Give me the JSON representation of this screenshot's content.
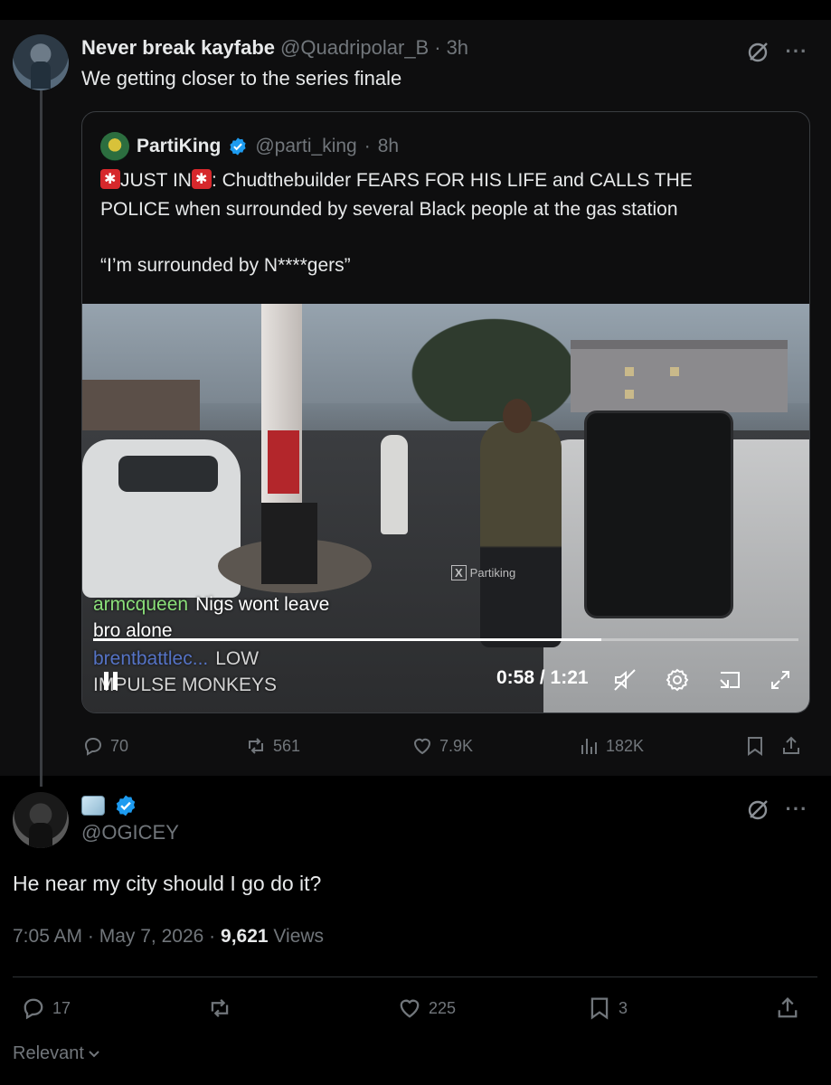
{
  "parent_tweet": {
    "display_name": "Never break kayfabe",
    "handle": "@Quadripolar_B",
    "separator": "·",
    "time": "3h",
    "text": "We getting closer to the series finale"
  },
  "quoted_tweet": {
    "display_name": "PartiKing",
    "handle": "@parti_king",
    "separator": "·",
    "time": "8h",
    "line1_a": "JUST IN",
    "line1_b": ": Chudthebuilder FEARS FOR HIS LIFE and CALLS THE",
    "line2": "POLICE when surrounded by several Black people at the gas station",
    "quote": "“I’m surrounded by N****gers”",
    "video": {
      "watermark": "Partiking",
      "chat": [
        {
          "user": "armcqueen",
          "message_a": "Nigs wont leave",
          "message_b": "bro alone"
        },
        {
          "user": "brentbattlec...",
          "message_a": "LOW",
          "message_b": "IMPULSE MONKEYS"
        }
      ],
      "time_display": "0:58 / 1:21",
      "progress": 0.72
    },
    "accent_color": "#1d9bf0"
  },
  "parent_actions": {
    "replies": "70",
    "reposts": "561",
    "likes": "7.9K",
    "views": "182K"
  },
  "reply_tweet": {
    "handle": "@OGICEY",
    "text": "He near my city should I go do it?",
    "time": "7:05 AM",
    "date": "May 7, 2026",
    "sep1": "·",
    "sep2": "·",
    "views_count": "9,621",
    "views_label": "Views",
    "actions": {
      "replies": "17",
      "reposts": "",
      "likes": "225",
      "bookmarks": "3"
    }
  },
  "sort": {
    "label": "Relevant"
  },
  "icons": {
    "grok": "grok-icon",
    "more": "more-icon",
    "verified": "verified-badge-icon",
    "siren": "siren-emoji-icon",
    "reply": "reply-icon",
    "repost": "repost-icon",
    "like": "heart-icon",
    "views": "views-chart-icon",
    "bookmark": "bookmark-icon",
    "share": "share-icon",
    "pause": "pause-icon",
    "mute": "muted-speaker-icon",
    "settings": "gear-icon",
    "pip": "picture-in-picture-icon",
    "fullscreen": "expand-icon"
  }
}
